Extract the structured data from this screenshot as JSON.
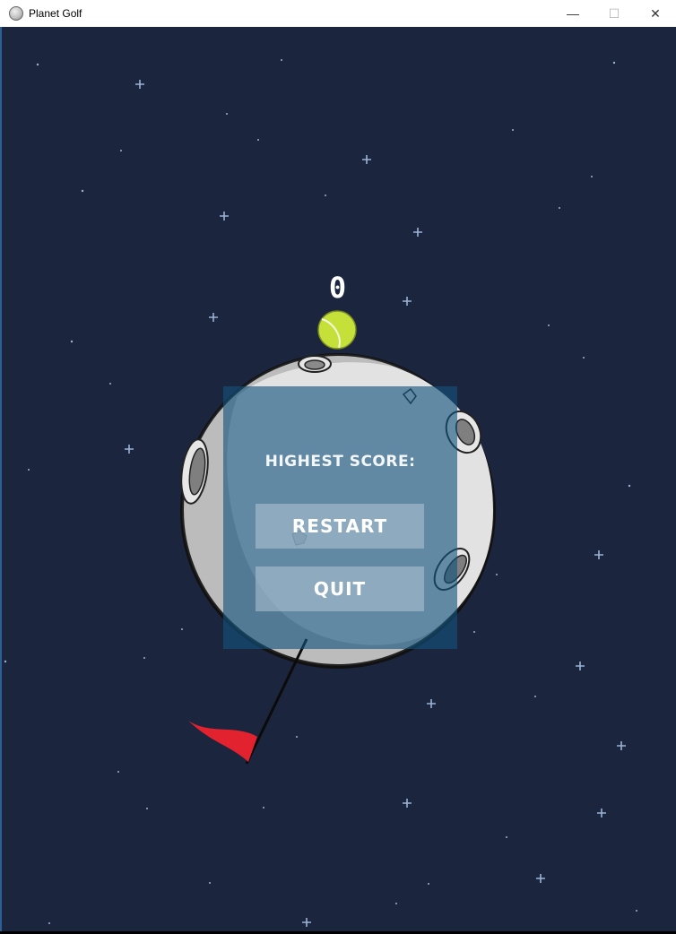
{
  "window": {
    "title": "Planet Golf",
    "minimize_glyph": "—",
    "maximize_glyph": "☐",
    "close_glyph": "✕"
  },
  "game": {
    "score": "0",
    "menu": {
      "highest_score_label": "HIGHEST SCORE:",
      "restart_label": "RESTART",
      "quit_label": "QUIT"
    }
  },
  "colors": {
    "sky": "#1b253e",
    "planet": "#d9d9d9",
    "ball": "#c6e03a",
    "flag": "#e2222e",
    "panel": "#13527d"
  },
  "icons": {
    "app": "planet-icon",
    "ball": "tennis-ball",
    "flag": "red-flag"
  }
}
